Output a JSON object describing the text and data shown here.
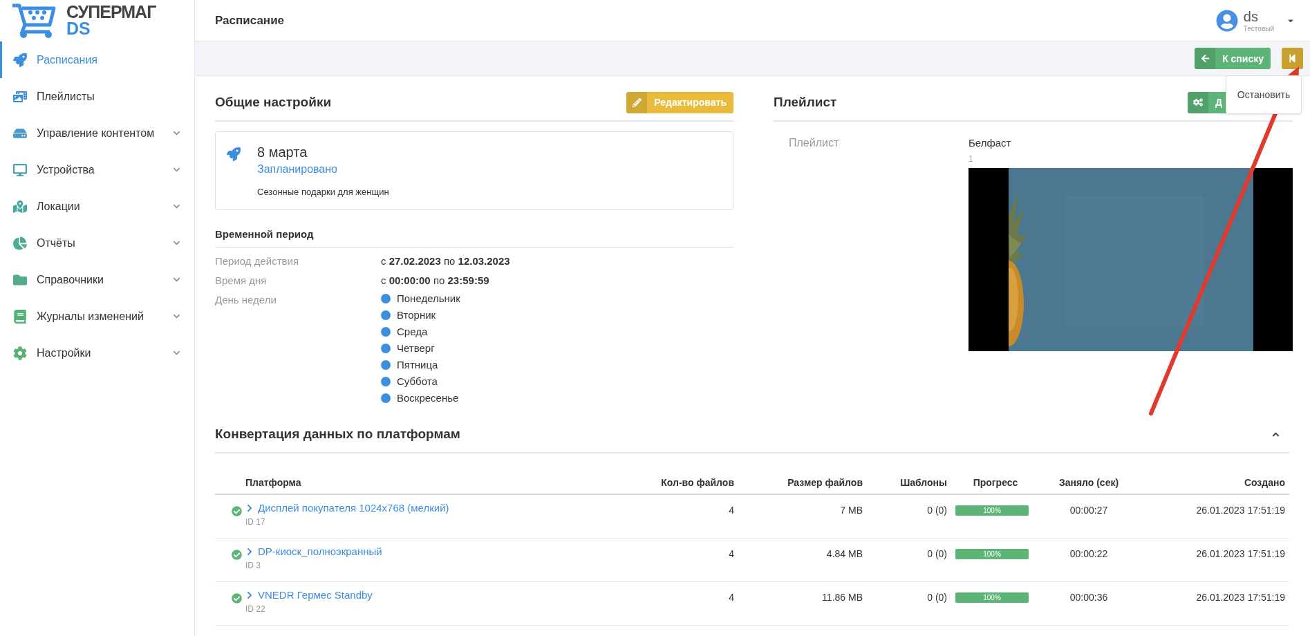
{
  "sidebar": {
    "logo": {
      "name": "СУПЕРМАГ",
      "suffix": "DS"
    },
    "items": [
      {
        "label": "Расписания",
        "selected": true,
        "expandable": false
      },
      {
        "label": "Плейлисты",
        "selected": false,
        "expandable": false
      },
      {
        "label": "Управление контентом",
        "selected": false,
        "expandable": true
      },
      {
        "label": "Устройства",
        "selected": false,
        "expandable": true
      },
      {
        "label": "Локации",
        "selected": false,
        "expandable": true
      },
      {
        "label": "Отчёты",
        "selected": false,
        "expandable": true
      },
      {
        "label": "Справочники",
        "selected": false,
        "expandable": true
      },
      {
        "label": "Журналы изменений",
        "selected": false,
        "expandable": true
      },
      {
        "label": "Настройки",
        "selected": false,
        "expandable": true
      }
    ]
  },
  "header": {
    "title": "Расписание",
    "user": {
      "name": "ds",
      "role": "Тестовый"
    }
  },
  "toolbar": {
    "back_button": "К списку",
    "stop_button": {
      "tooltip": "Остановить"
    }
  },
  "general": {
    "title": "Общие настройки",
    "edit_button": "Редактировать",
    "card": {
      "name": "8 марта",
      "status": "Запланировано",
      "description": "Сезонные подарки для женщин"
    },
    "period": {
      "title": "Временной период",
      "rows": [
        {
          "label": "Период действия",
          "value": "с **27.02.2023** по **12.03.2023**"
        },
        {
          "label": "Время дня",
          "value": "с **00:00:00** по **23:59:59**"
        }
      ],
      "weekdays_label": "День недели",
      "weekdays": [
        {
          "label": "Понедельник",
          "selected": true
        },
        {
          "label": "Вторник",
          "selected": true
        },
        {
          "label": "Среда",
          "selected": true
        },
        {
          "label": "Четверг",
          "selected": true
        },
        {
          "label": "Пятница",
          "selected": true
        },
        {
          "label": "Суббота",
          "selected": true
        },
        {
          "label": "Воскресенье",
          "selected": true
        }
      ]
    }
  },
  "playlist": {
    "title": "Плейлист",
    "action_button": "Д",
    "label": "Плейлист",
    "name": "Белфаст",
    "count": "1"
  },
  "conversion": {
    "title": "Конвертация данных по платформам",
    "expanded": true,
    "columns": [
      "Платформа",
      "Кол-во файлов",
      "Размер файлов",
      "Шаблоны",
      "Прогресс",
      "Заняло (сек)",
      "Создано"
    ],
    "rows": [
      {
        "platform": "Дисплей покупателя 1024x768 (мелкий)",
        "id": "ID 17",
        "files": "4",
        "size": "7 MB",
        "templates": "0 (0)",
        "level": 1,
        "progress": "100%",
        "taken": "00:00:27",
        "created": "26.01.2023 17:51:19"
      },
      {
        "platform": "DP-киоск_полноэкранный",
        "id": "ID 3",
        "files": "4",
        "size": "4.84 MB",
        "templates": "0 (0)",
        "level": 1,
        "progress": "100%",
        "taken": "00:00:22",
        "created": "26.01.2023 17:51:19"
      },
      {
        "platform": "VNEDR Гермес Standby",
        "id": "ID 22",
        "files": "4",
        "size": "11.86 MB",
        "templates": "0 (0)",
        "level": 1,
        "progress": "100%",
        "taken": "00:00:36",
        "created": "26.01.2023 17:51:19"
      }
    ]
  }
}
